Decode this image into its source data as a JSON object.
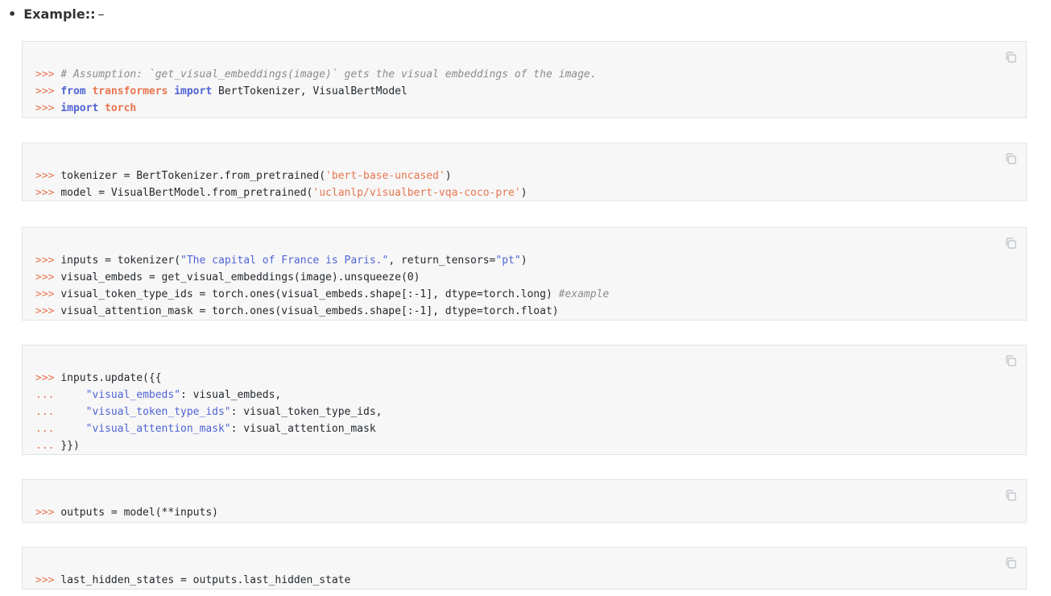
{
  "section": {
    "title": "Example:",
    "suffix": ":",
    "dash": "–"
  },
  "blocks": [
    [
      [
        {
          "t": ">>> ",
          "c": "prompt"
        },
        {
          "t": "# Assumption: `get_visual_embeddings(image)` gets the visual embeddings of the image.",
          "c": "comment"
        }
      ],
      [
        {
          "t": ">>> ",
          "c": "prompt"
        },
        {
          "t": "from",
          "c": "kw"
        },
        {
          "t": " ",
          "c": ""
        },
        {
          "t": "transformers",
          "c": "mod"
        },
        {
          "t": " ",
          "c": ""
        },
        {
          "t": "import",
          "c": "kw"
        },
        {
          "t": " BertTokenizer, VisualBertModel",
          "c": ""
        }
      ],
      [
        {
          "t": ">>> ",
          "c": "prompt"
        },
        {
          "t": "import",
          "c": "kw"
        },
        {
          "t": " ",
          "c": ""
        },
        {
          "t": "torch",
          "c": "mod"
        }
      ]
    ],
    [
      [
        {
          "t": ">>> ",
          "c": "prompt"
        },
        {
          "t": "tokenizer = BertTokenizer.from_pretrained(",
          "c": ""
        },
        {
          "t": "'bert-base-uncased'",
          "c": "str-orange"
        },
        {
          "t": ")",
          "c": ""
        }
      ],
      [
        {
          "t": ">>> ",
          "c": "prompt"
        },
        {
          "t": "model = VisualBertModel.from_pretrained(",
          "c": ""
        },
        {
          "t": "'uclanlp/visualbert-vqa-coco-pre'",
          "c": "str-orange"
        },
        {
          "t": ")",
          "c": ""
        }
      ]
    ],
    [
      [
        {
          "t": ">>> ",
          "c": "prompt"
        },
        {
          "t": "inputs = tokenizer(",
          "c": ""
        },
        {
          "t": "\"The capital of France is Paris.\"",
          "c": "str-blue"
        },
        {
          "t": ", return_tensors=",
          "c": ""
        },
        {
          "t": "\"pt\"",
          "c": "str-blue"
        },
        {
          "t": ")",
          "c": ""
        }
      ],
      [
        {
          "t": ">>> ",
          "c": "prompt"
        },
        {
          "t": "visual_embeds = get_visual_embeddings(image).unsqueeze(0)",
          "c": ""
        }
      ],
      [
        {
          "t": ">>> ",
          "c": "prompt"
        },
        {
          "t": "visual_token_type_ids = torch.ones(visual_embeds.shape[:-1], dtype=torch.long) ",
          "c": ""
        },
        {
          "t": "#example",
          "c": "comment"
        }
      ],
      [
        {
          "t": ">>> ",
          "c": "prompt"
        },
        {
          "t": "visual_attention_mask = torch.ones(visual_embeds.shape[:-1], dtype=torch.float)",
          "c": ""
        }
      ]
    ],
    [
      [
        {
          "t": ">>> ",
          "c": "prompt"
        },
        {
          "t": "inputs.update({{",
          "c": ""
        }
      ],
      [
        {
          "t": "... ",
          "c": "prompt"
        },
        {
          "t": "    ",
          "c": ""
        },
        {
          "t": "\"visual_embeds\"",
          "c": "str-blue"
        },
        {
          "t": ": visual_embeds,",
          "c": ""
        }
      ],
      [
        {
          "t": "... ",
          "c": "prompt"
        },
        {
          "t": "    ",
          "c": ""
        },
        {
          "t": "\"visual_token_type_ids\"",
          "c": "str-blue"
        },
        {
          "t": ": visual_token_type_ids,",
          "c": ""
        }
      ],
      [
        {
          "t": "... ",
          "c": "prompt"
        },
        {
          "t": "    ",
          "c": ""
        },
        {
          "t": "\"visual_attention_mask\"",
          "c": "str-blue"
        },
        {
          "t": ": visual_attention_mask",
          "c": ""
        }
      ],
      [
        {
          "t": "... ",
          "c": "prompt"
        },
        {
          "t": "}})",
          "c": ""
        }
      ]
    ],
    [
      [
        {
          "t": ">>> ",
          "c": "prompt"
        },
        {
          "t": "outputs = model(**inputs)",
          "c": ""
        }
      ]
    ],
    [
      [
        {
          "t": ">>> ",
          "c": "prompt"
        },
        {
          "t": "last_hidden_states = outputs.last_hidden_state",
          "c": ""
        }
      ]
    ]
  ],
  "icons": {
    "copy": "copy-icon"
  },
  "colors": {
    "prompt": "#e8744f",
    "keyword": "#5063d6",
    "string_blue": "#5063d6",
    "string_orange": "#e8744f",
    "comment": "#8b8b8b",
    "block_bg": "#f7f7f7"
  }
}
